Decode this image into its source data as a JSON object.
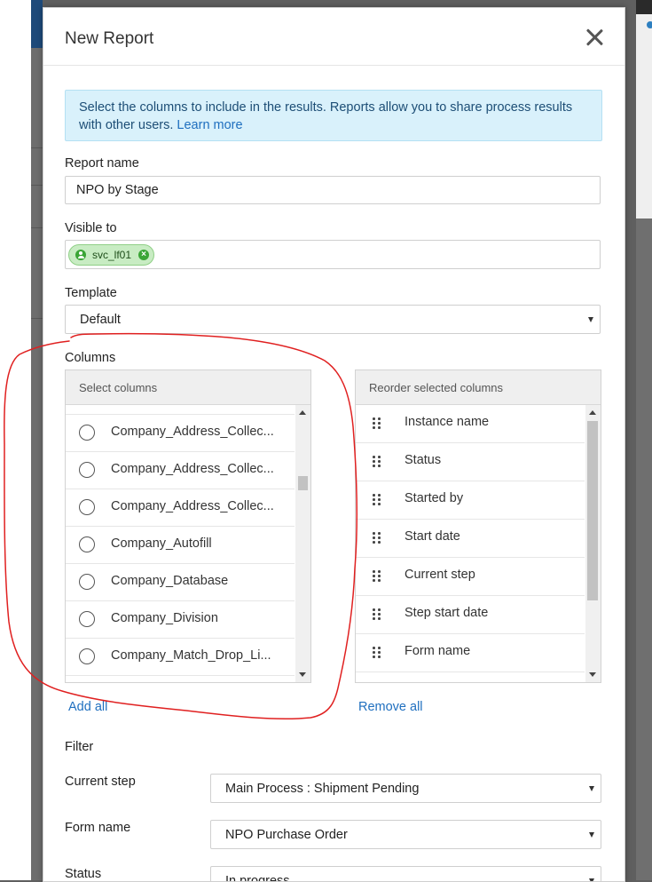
{
  "modal": {
    "title": "New Report",
    "info": {
      "text": "Select the columns to include in the results. Reports allow you to share process results with other users.",
      "link": "Learn more"
    },
    "report_name": {
      "label": "Report name",
      "value": "NPO by Stage"
    },
    "visible_to": {
      "label": "Visible to",
      "chip": "svc_lf01"
    },
    "template": {
      "label": "Template",
      "value": "Default"
    },
    "columns": {
      "label": "Columns",
      "select_header": "Select columns",
      "reorder_header": "Reorder selected columns",
      "available": [
        "Company_Address_Collec...",
        "Company_Address_Collec...",
        "Company_Address_Collec...",
        "Company_Autofill",
        "Company_Database",
        "Company_Division",
        "Company_Match_Drop_Li..."
      ],
      "selected": [
        "Instance name",
        "Status",
        "Started by",
        "Start date",
        "Current step",
        "Step start date",
        "Form name"
      ],
      "add_all": "Add all",
      "remove_all": "Remove all"
    },
    "filter": {
      "label": "Filter",
      "current_step": {
        "label": "Current step",
        "value": "Main Process : Shipment Pending"
      },
      "form_name": {
        "label": "Form name",
        "value": "NPO Purchase Order"
      },
      "status": {
        "label": "Status",
        "value": "In progress"
      }
    }
  },
  "colors": {
    "accent_link": "#1f6fbf",
    "info_bg": "#d9f1fb",
    "chip_bg": "#c8ecc3",
    "annotation_red": "#e02020"
  }
}
